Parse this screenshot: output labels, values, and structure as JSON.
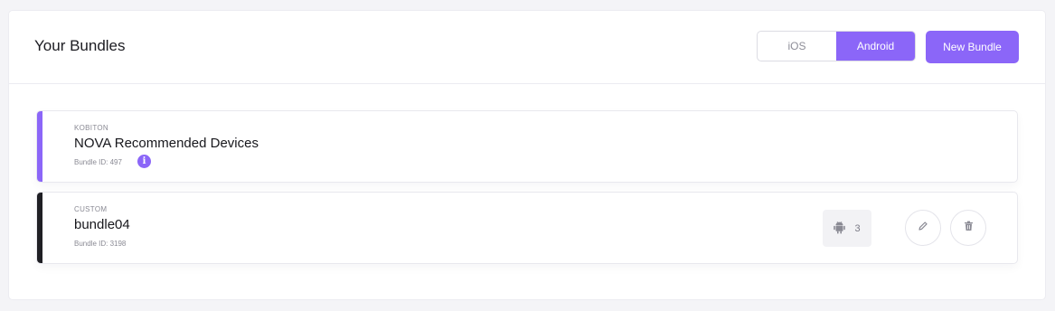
{
  "header": {
    "title": "Your Bundles",
    "platform_toggle": {
      "options": [
        "iOS",
        "Android"
      ],
      "selected": "Android"
    },
    "new_bundle_label": "New Bundle"
  },
  "bundles": [
    {
      "source": "KOBITON",
      "name": "NOVA Recommended Devices",
      "bundle_id_text": "Bundle ID: 497",
      "accent_color": "#8b66f8",
      "has_info_icon": true
    },
    {
      "source": "CUSTOM",
      "name": "bundle04",
      "bundle_id_text": "Bundle ID: 3198",
      "accent_color": "#1f1f24",
      "device_count": "3",
      "device_platform_icon": "android-icon",
      "actions": [
        "edit-icon",
        "delete-icon"
      ]
    }
  ],
  "colors": {
    "accent": "#8b66f8",
    "background": "#f4f4f7"
  }
}
